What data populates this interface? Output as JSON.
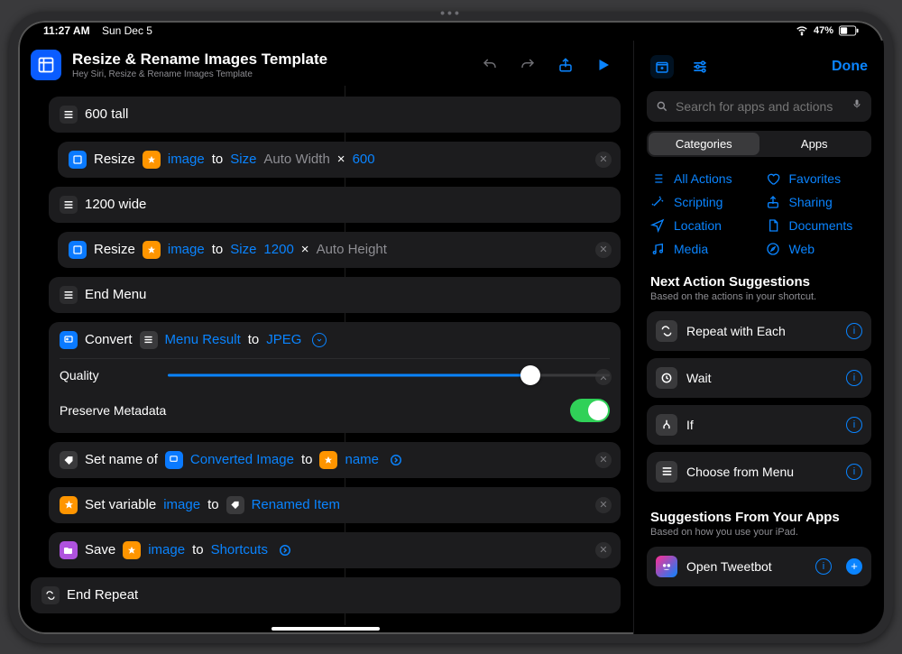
{
  "status": {
    "time": "11:27 AM",
    "date": "Sun Dec 5",
    "battery_pct": "47%"
  },
  "header": {
    "title": "Resize & Rename Images Template",
    "subtitle": "Hey Siri, Resize & Rename Images Template"
  },
  "editor": {
    "menu600_label": "600 tall",
    "resize_label": "Resize",
    "image_token": "image",
    "to_word": "to",
    "size_word": "Size",
    "auto_width": "Auto Width",
    "times": "×",
    "v600": "600",
    "menu1200_label": "1200 wide",
    "v1200": "1200",
    "auto_height": "Auto Height",
    "end_menu": "End Menu",
    "convert_label": "Convert",
    "menu_result": "Menu Result",
    "jpeg": "JPEG",
    "quality_label": "Quality",
    "preserve_meta": "Preserve Metadata",
    "set_name_of": "Set name of",
    "converted_image": "Converted Image",
    "name_token": "name",
    "set_variable": "Set variable",
    "renamed_item": "Renamed Item",
    "save_label": "Save",
    "shortcuts": "Shortcuts",
    "end_repeat": "End Repeat"
  },
  "sidebar": {
    "done": "Done",
    "search_placeholder": "Search for apps and actions",
    "seg": {
      "categories": "Categories",
      "apps": "Apps"
    },
    "cats": {
      "all": "All Actions",
      "favorites": "Favorites",
      "scripting": "Scripting",
      "sharing": "Sharing",
      "location": "Location",
      "documents": "Documents",
      "media": "Media",
      "web": "Web"
    },
    "next_title": "Next Action Suggestions",
    "next_sub": "Based on the actions in your shortcut.",
    "suggestions": {
      "repeat": "Repeat with Each",
      "wait": "Wait",
      "iff": "If",
      "choose": "Choose from Menu"
    },
    "from_apps_title": "Suggestions From Your Apps",
    "from_apps_sub": "Based on how you use your iPad.",
    "tweetbot": "Open Tweetbot"
  }
}
